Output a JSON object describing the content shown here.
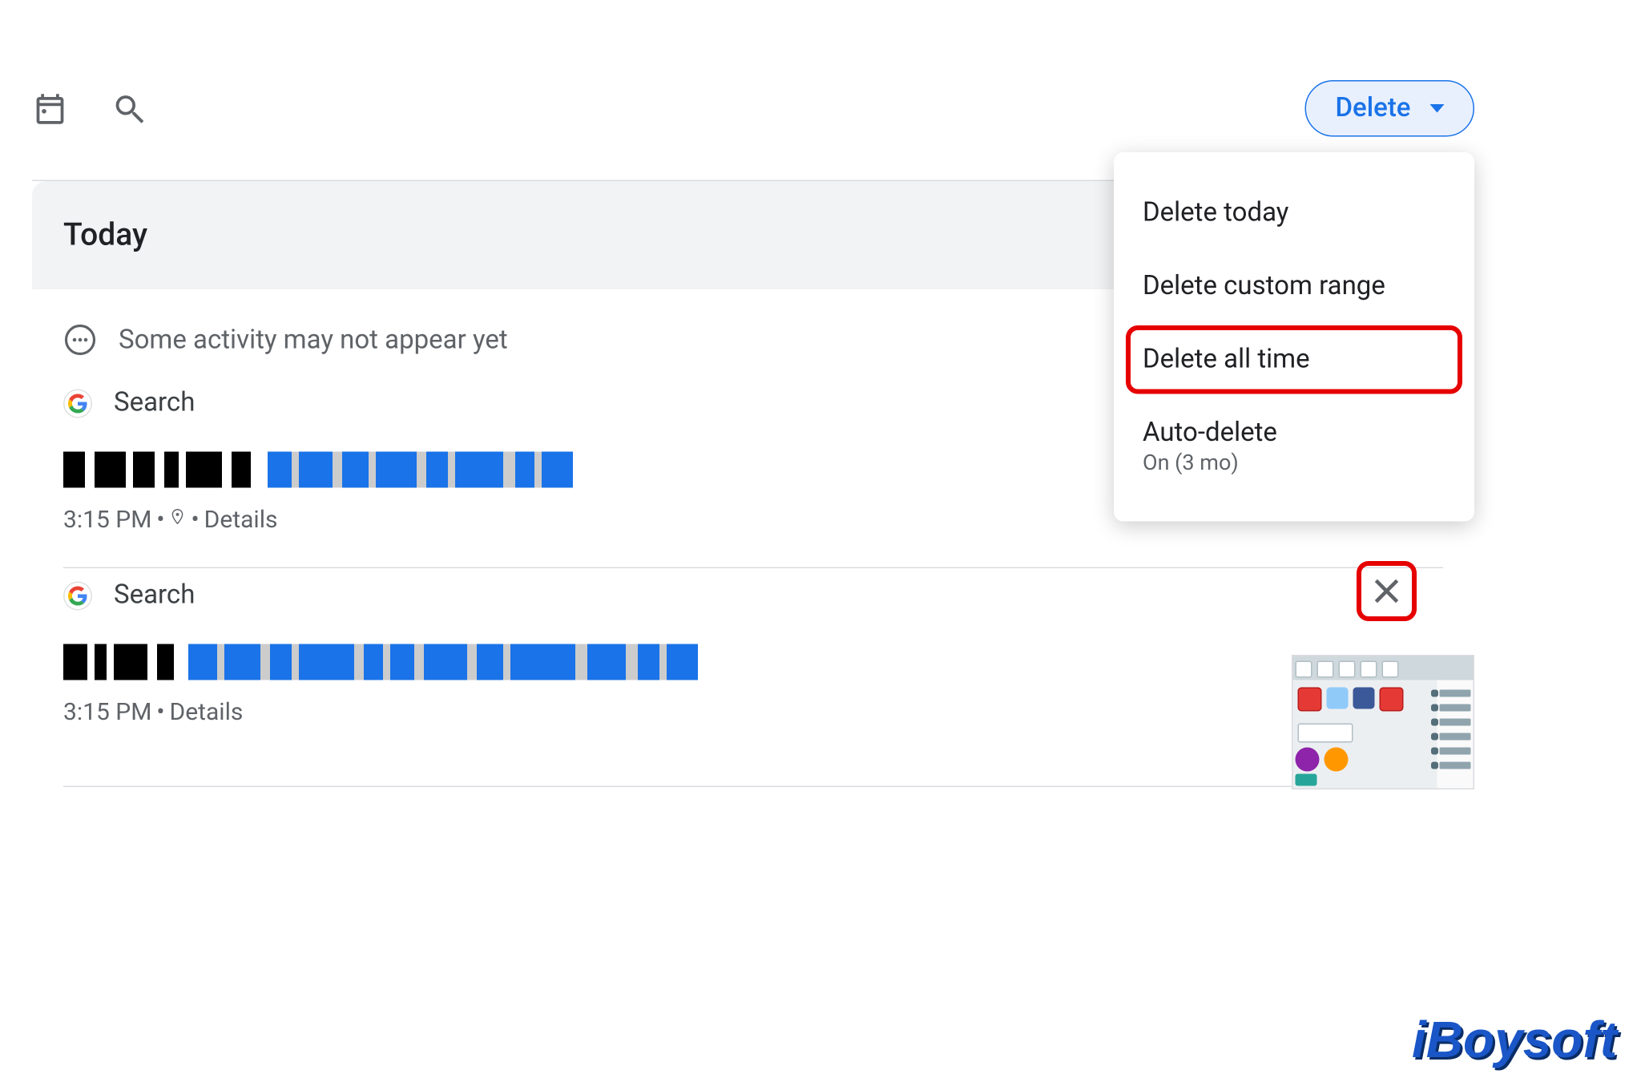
{
  "header": {
    "delete_label": "Delete"
  },
  "section": {
    "title": "Today"
  },
  "notice": {
    "text": "Some activity may not appear yet"
  },
  "activities": [
    {
      "source_label": "Search",
      "redacted_title": "Searched for …",
      "time": "3:15 PM",
      "details_label": "Details",
      "has_location": true,
      "has_close": false,
      "has_thumbnail": false
    },
    {
      "source_label": "Search",
      "redacted_title": "Visited How to … History …",
      "time": "3:15 PM",
      "details_label": "Details",
      "has_location": false,
      "has_close": true,
      "has_thumbnail": true
    }
  ],
  "dropdown": {
    "items": [
      {
        "label": "Delete today",
        "highlighted": false
      },
      {
        "label": "Delete custom range",
        "highlighted": false
      },
      {
        "label": "Delete all time",
        "highlighted": true
      },
      {
        "label": "Auto-delete",
        "sub": "On (3 mo)",
        "highlighted": false
      }
    ]
  },
  "watermark": {
    "text": "iBoysoft"
  },
  "colors": {
    "accent": "#1a73e8",
    "highlight": "#e60000"
  }
}
